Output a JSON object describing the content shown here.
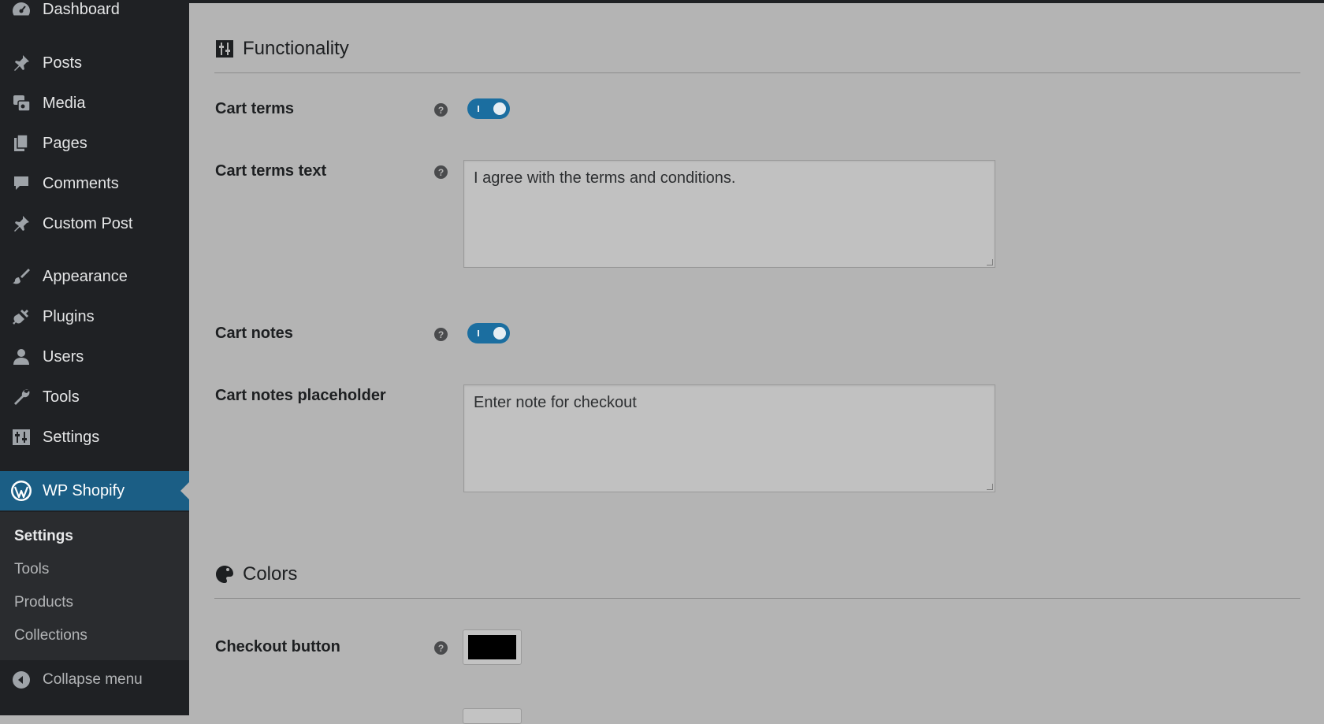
{
  "sidebar": {
    "items": [
      {
        "label": "Dashboard",
        "icon": "dashboard-icon"
      },
      {
        "label": "Posts",
        "icon": "pin-icon"
      },
      {
        "label": "Media",
        "icon": "media-icon"
      },
      {
        "label": "Pages",
        "icon": "pages-icon"
      },
      {
        "label": "Comments",
        "icon": "comment-icon"
      },
      {
        "label": "Custom Post",
        "icon": "pin-icon"
      },
      {
        "label": "Appearance",
        "icon": "brush-icon"
      },
      {
        "label": "Plugins",
        "icon": "plug-icon"
      },
      {
        "label": "Users",
        "icon": "user-icon"
      },
      {
        "label": "Tools",
        "icon": "wrench-icon"
      },
      {
        "label": "Settings",
        "icon": "settings-icon"
      }
    ],
    "active": {
      "label": "WP Shopify",
      "icon": "wordpress-icon"
    },
    "submenu": [
      "Settings",
      "Tools",
      "Products",
      "Collections"
    ],
    "collapse_label": "Collapse menu"
  },
  "functionality": {
    "title": "Functionality",
    "cart_terms_label": "Cart terms",
    "cart_terms_enabled": true,
    "cart_terms_text_label": "Cart terms text",
    "cart_terms_text_value": "I agree with the terms and conditions.",
    "cart_notes_label": "Cart notes",
    "cart_notes_enabled": true,
    "cart_notes_placeholder_label": "Cart notes placeholder",
    "cart_notes_placeholder_value": "Enter note for checkout"
  },
  "colors": {
    "title": "Colors",
    "checkout_button_label": "Checkout button",
    "checkout_button_color": "#000000"
  },
  "help_glyph": "?",
  "theme": {
    "accent": "#1b6ea0",
    "sidebar_bg": "#1f2124"
  }
}
